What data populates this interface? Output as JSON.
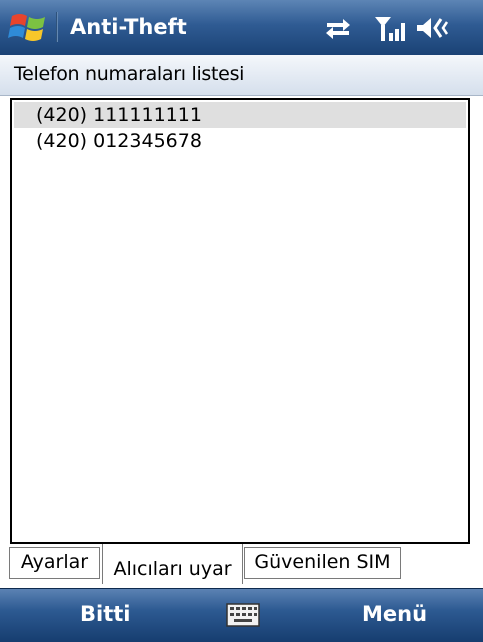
{
  "titlebar": {
    "title": "Anti-Theft",
    "icons": [
      "windows-start-icon",
      "connectivity-icon",
      "signal-strength-icon",
      "volume-icon"
    ]
  },
  "header": {
    "title": "Telefon numaraları listesi"
  },
  "phone_list": {
    "items": [
      "(420) 111111111",
      "(420) 012345678"
    ],
    "selected_index": 0
  },
  "tabs": [
    {
      "label": "Ayarlar",
      "active": false
    },
    {
      "label": "Alıcıları uyar",
      "active": true
    },
    {
      "label": "Güvenilen SIM",
      "active": false
    }
  ],
  "softkeys": {
    "left": "Bitti",
    "center_icon": "keyboard-icon",
    "right": "Menü"
  },
  "colors": {
    "titlebar": "#2f5b93",
    "softbar": "#2d5a92",
    "selection": "#dfdfdf",
    "header": "#d5dfec"
  }
}
